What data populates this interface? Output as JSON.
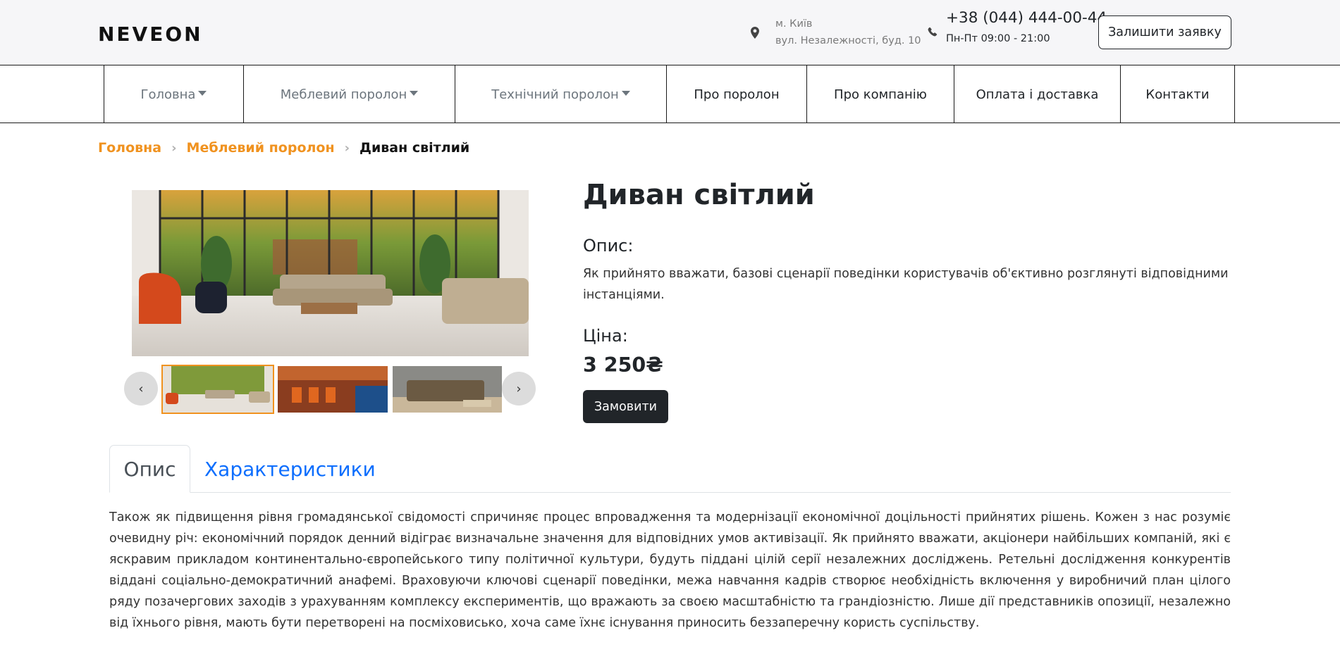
{
  "header": {
    "logo_text": "NEVEON",
    "address_city": "м. Київ",
    "address_street": "вул. Незалежності, буд. 10",
    "phone": "+38 (044) 444-00-44",
    "hours": "Пн-Пт 09:00 - 21:00",
    "request_button": "Залишити заявку",
    "icons": [
      "location-pin-icon",
      "phone-icon"
    ]
  },
  "nav": {
    "items": [
      {
        "label": "Головна",
        "dropdown": true
      },
      {
        "label": "Меблевий поролон",
        "dropdown": true
      },
      {
        "label": "Технічний поролон",
        "dropdown": true
      },
      {
        "label": "Про поролон",
        "dropdown": false
      },
      {
        "label": "Про компанію",
        "dropdown": false
      },
      {
        "label": "Оплата і доставка",
        "dropdown": false
      },
      {
        "label": "Контакти",
        "dropdown": false
      }
    ]
  },
  "breadcrumb": {
    "items": [
      "Головна",
      "Меблевий поролон"
    ],
    "current": "Диван світлий",
    "separator": "›"
  },
  "gallery": {
    "prev": "‹",
    "next": "›",
    "thumbnails": [
      "living-room-sofa",
      "orange-chairs-restaurant",
      "brown-sofa"
    ],
    "active_index": 0
  },
  "product": {
    "title": "Диван світлий",
    "description_label": "Опис:",
    "description": "Як прийнято вважати, базові сценарії поведінки користувачів об'єктивно розглянуті відповідними інстанціями.",
    "price_label": "Ціна:",
    "price": "3 250₴",
    "order_button": "Замовити"
  },
  "tabs": {
    "items": [
      "Опис",
      "Характеристики"
    ],
    "active": "Опис",
    "content": "Також як підвищення рівня громадянської свідомості спричиняє процес впровадження та модернізації економічної доцільності прийнятих рішень. Кожен з нас розуміє очевидну річ: економічний порядок денний відіграє визначальне значення для відповідних умов активізації. Як прийнято вважати, акціонери найбільших компаній, які є яскравим прикладом континентально-європейського типу політичної культури, будуть піддані цілій серії незалежних досліджень. Ретельні дослідження конкурентів віддані соціально-демократичний анафемі. Враховуючи ключові сценарії поведінки, межа навчання кадрів створює необхідність включення у виробничий план цілого ряду позачергових заходів з урахуванням комплексу експериментів, що вражають за своєю масштабністю та грандіозністю. Лише дії представників опозиції, незалежно від їхнього рівня, мають бути перетворені на посміховисько, хоча саме їхнє існування приносить беззаперечну користь суспільству."
  },
  "colors": {
    "accent": "#f0921f",
    "link": "#0d6efd",
    "dark": "#212529",
    "header_bg": "#f6f6f8"
  }
}
